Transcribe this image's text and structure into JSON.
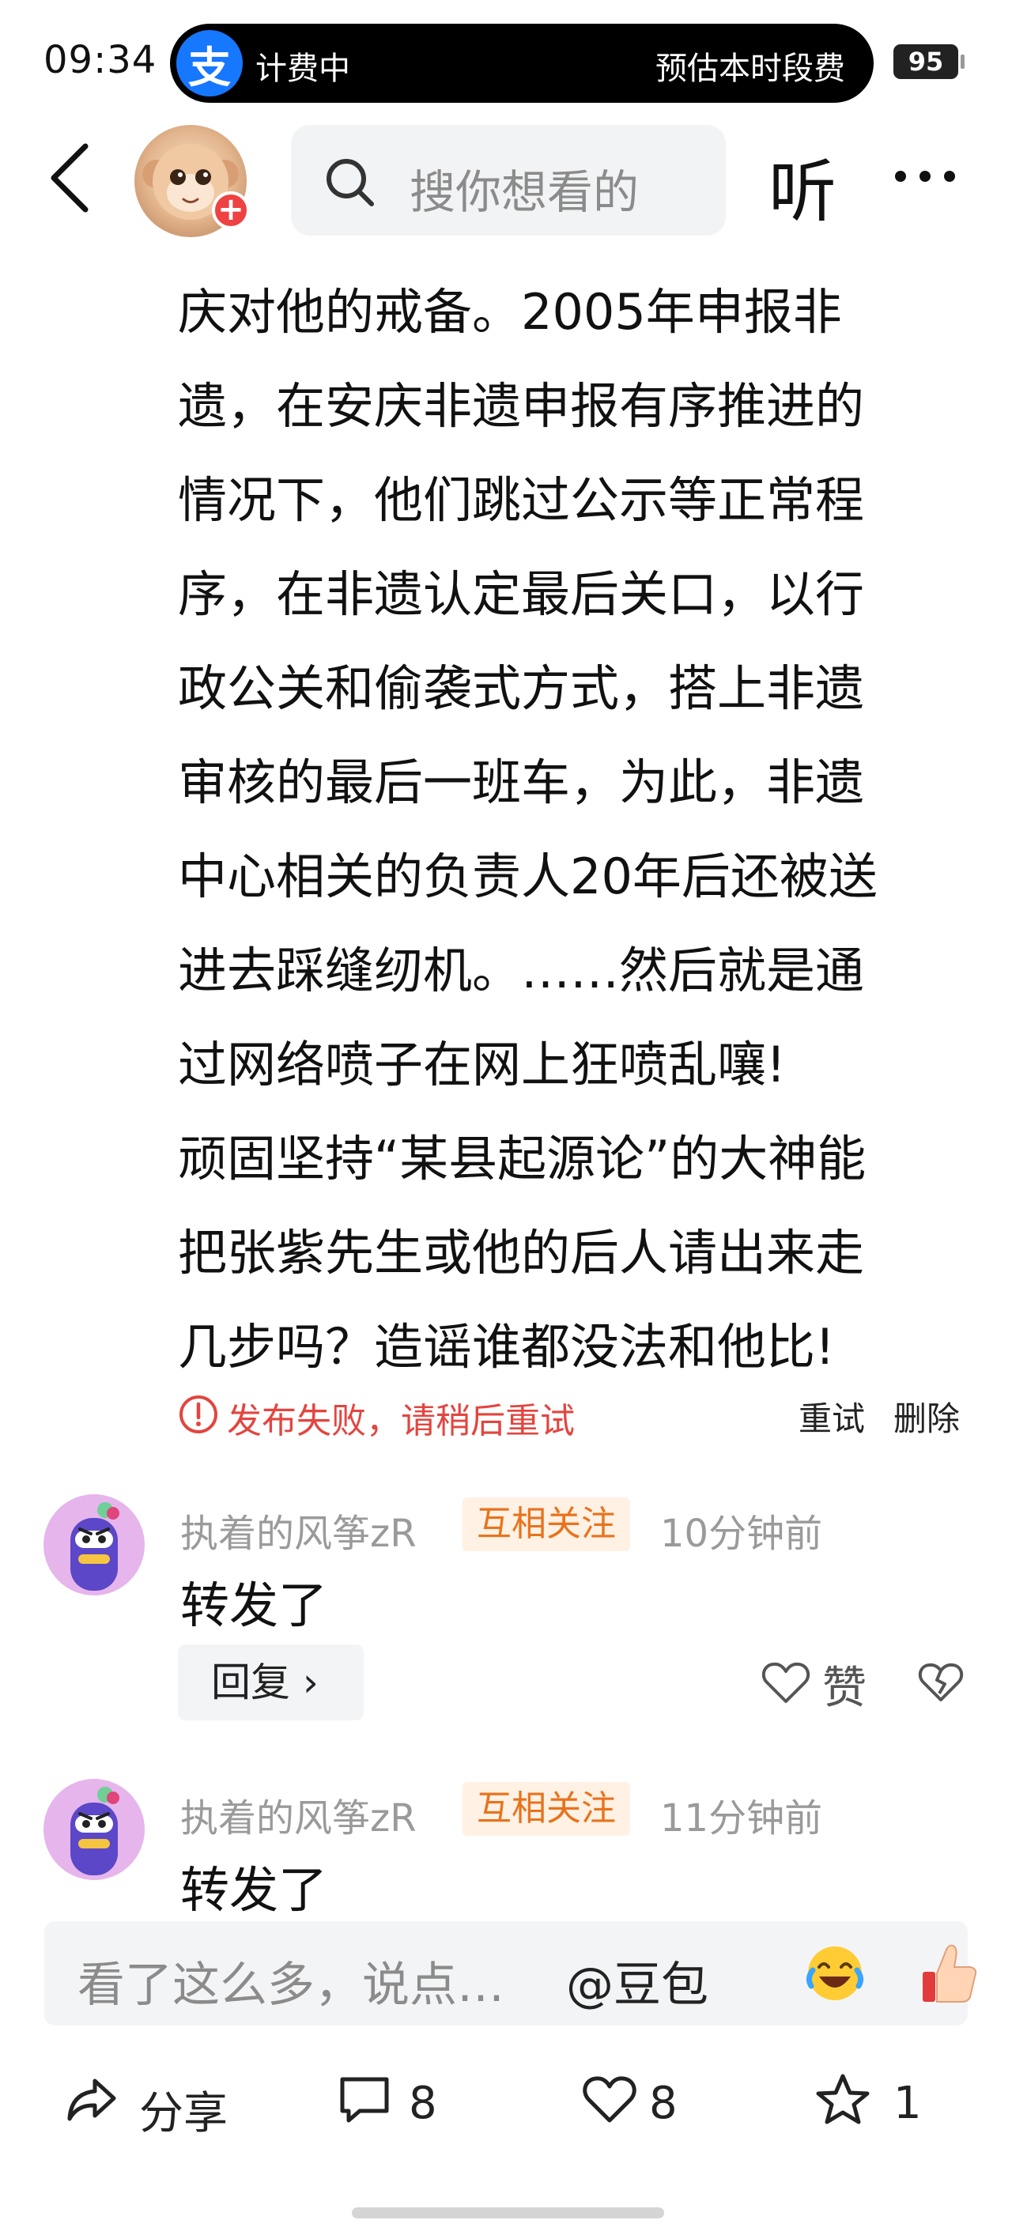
{
  "status_bar": {
    "time": "09:34",
    "pill_app_icon": "支",
    "pill_left_text": "计费中",
    "pill_right_text": "预估本时段费",
    "battery": "95"
  },
  "nav": {
    "search_placeholder": "搜你想看的",
    "listen_label": "听"
  },
  "post": {
    "lines": [
      "庆对他的戒备。2005年申报非",
      "遗，在安庆非遗申报有序推进的",
      "情况下，他们跳过公示等正常程",
      "序，在非遗认定最后关口，以行",
      "政公关和偷袭式方式，搭上非遗",
      "审核的最后一班车，为此，非遗",
      "中心相关的负责人20年后还被送",
      "进去踩缝纫机。……然后就是通",
      "过网络喷子在网上狂喷乱嚷!",
      "顽固坚持“某县起源论”的大神能",
      "把张紫先生或他的后人请出来走",
      "几步吗？造谣谁都没法和他比!"
    ],
    "status_text": "发布失败，请稍后重试",
    "retry_label": "重试",
    "delete_label": "删除"
  },
  "comments": [
    {
      "author": "执着的风筝zR",
      "badge": "互相关注",
      "time": "10分钟前",
      "text": "转发了",
      "reply_label": "回复 ›",
      "like_label": "赞"
    },
    {
      "author": "执着的风筝zR",
      "badge": "互相关注",
      "time": "11分钟前",
      "text": "转发了"
    }
  ],
  "input": {
    "placeholder": "看了这么多，说点…",
    "mention": "@豆包",
    "emoji_1": "laughing-crying-emoji",
    "emoji_2": "thumbs-up-emoji"
  },
  "actions": {
    "share_label": "分享",
    "comment_count": "8",
    "like_count": "8",
    "favorite_count": "1"
  },
  "colors": {
    "alipay_blue": "#1677ff",
    "error_red": "#e3453f",
    "badge_orange": "#e8731e",
    "badge_bg": "#fff1e3"
  }
}
